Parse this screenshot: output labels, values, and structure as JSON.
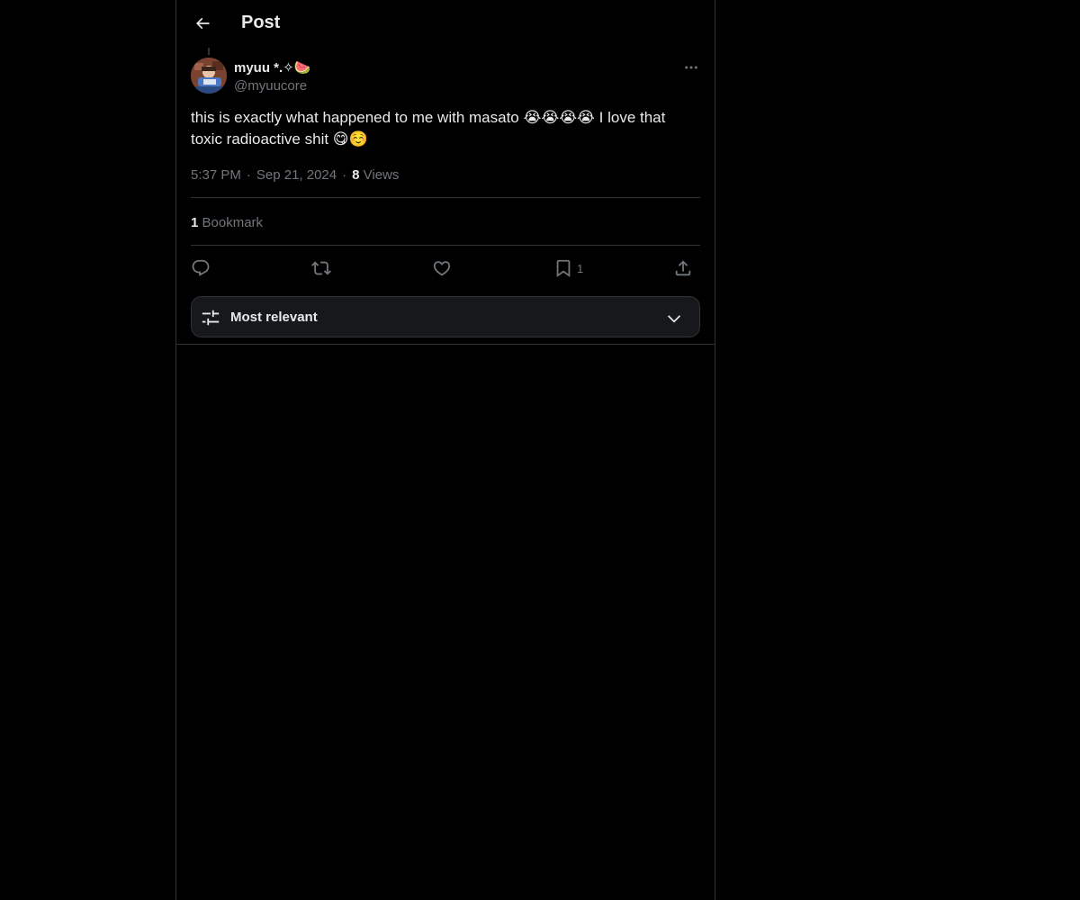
{
  "header": {
    "title": "Post",
    "back_icon": "arrow-left-icon"
  },
  "post": {
    "author_name": "myuu *.✧🍉",
    "author_handle": "@myuucore",
    "text": "this is exactly what happened to me with masato 😭😭😭😭 I love that toxic radioactive shit 😋☺️",
    "time": "5:37 PM",
    "date": "Sep 21, 2024",
    "views_count": "8",
    "views_label": "Views",
    "bookmarks_count": "1",
    "bookmarks_label": "Bookmark"
  },
  "actions": {
    "reply_icon": "reply-icon",
    "repost_icon": "repost-icon",
    "like_icon": "heart-icon",
    "bookmark_icon": "bookmark-icon",
    "bookmark_count": "1",
    "share_icon": "share-icon"
  },
  "sort": {
    "label": "Most relevant"
  },
  "colors": {
    "background": "#000000",
    "text": "#e7e9ea",
    "muted": "#71767b",
    "border": "#2f3336",
    "sort_bg": "#16181c"
  }
}
